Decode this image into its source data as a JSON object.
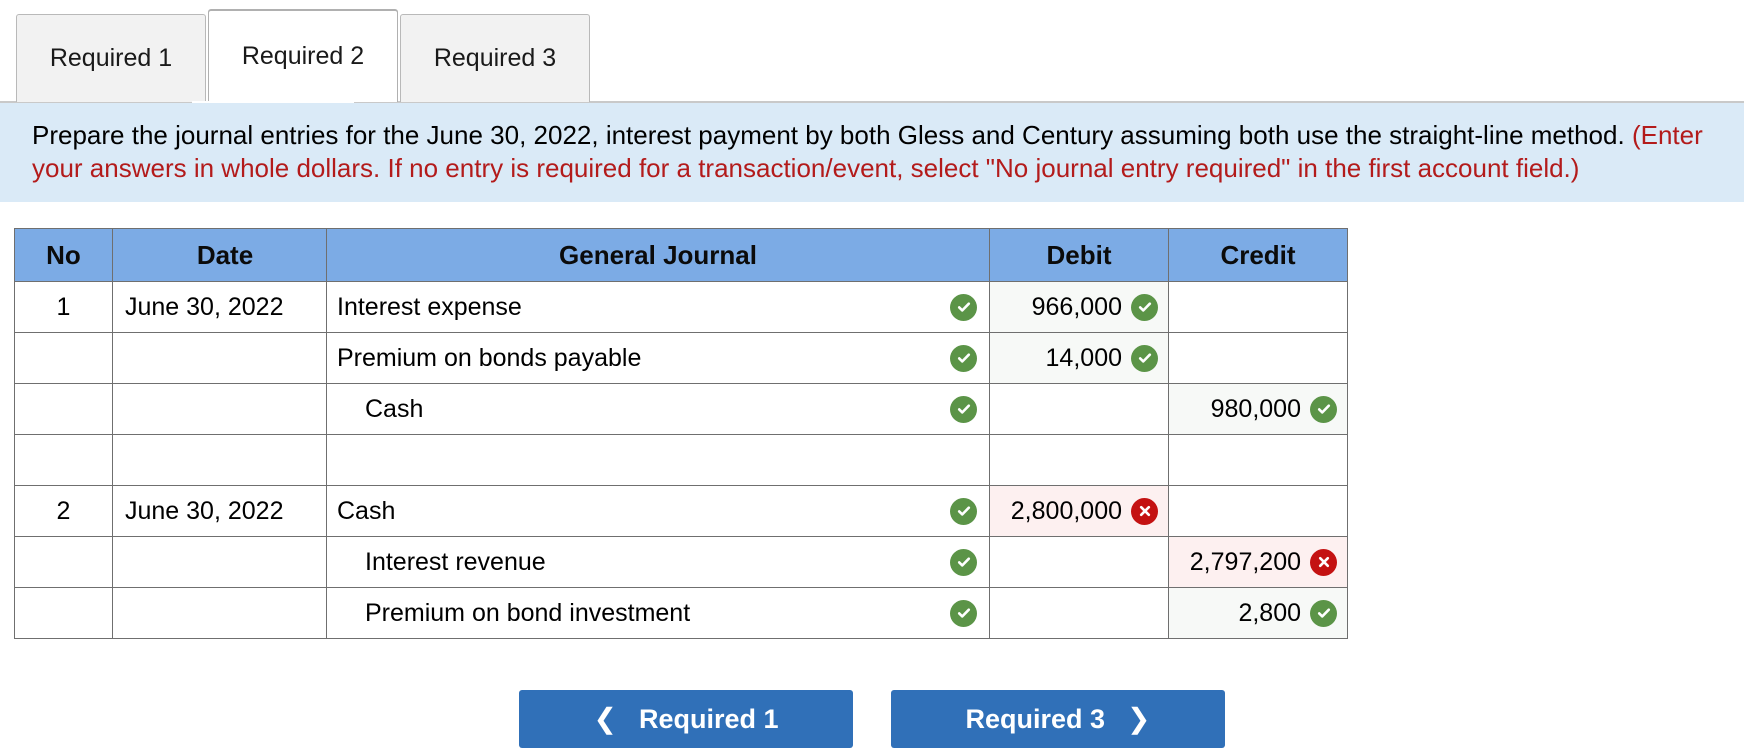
{
  "tabs": [
    {
      "label": "Required 1",
      "active": false
    },
    {
      "label": "Required 2",
      "active": true
    },
    {
      "label": "Required 3",
      "active": false
    }
  ],
  "instruction": {
    "black_text": "Prepare the journal entries for the June 30, 2022, interest payment by both Gless and Century assuming both use the straight-line method. ",
    "red_text": "(Enter your answers in whole dollars. If no entry is required for a transaction/event, select \"No journal entry required\" in the first account field.)"
  },
  "table": {
    "headers": [
      "No",
      "Date",
      "General Journal",
      "Debit",
      "Credit"
    ],
    "rows": [
      {
        "no": "1",
        "date": "June 30, 2022",
        "account": "Interest expense",
        "indent": false,
        "account_status": "ok",
        "debit": "966,000",
        "debit_status": "ok",
        "credit": "",
        "credit_status": "none"
      },
      {
        "no": "",
        "date": "",
        "account": "Premium on bonds payable",
        "indent": false,
        "account_status": "ok",
        "debit": "14,000",
        "debit_status": "ok",
        "credit": "",
        "credit_status": "none"
      },
      {
        "no": "",
        "date": "",
        "account": "Cash",
        "indent": true,
        "account_status": "ok",
        "debit": "",
        "debit_status": "none",
        "credit": "980,000",
        "credit_status": "ok"
      },
      {
        "no": "",
        "date": "",
        "account": "",
        "indent": false,
        "account_status": "none",
        "debit": "",
        "debit_status": "none",
        "credit": "",
        "credit_status": "none"
      },
      {
        "no": "2",
        "date": "June 30, 2022",
        "account": "Cash",
        "indent": false,
        "account_status": "ok",
        "debit": "2,800,000",
        "debit_status": "bad",
        "credit": "",
        "credit_status": "none"
      },
      {
        "no": "",
        "date": "",
        "account": "Interest revenue",
        "indent": true,
        "account_status": "ok",
        "debit": "",
        "debit_status": "none",
        "credit": "2,797,200",
        "credit_status": "bad"
      },
      {
        "no": "",
        "date": "",
        "account": "Premium on bond investment",
        "indent": true,
        "account_status": "ok",
        "debit": "",
        "debit_status": "none",
        "credit": "2,800",
        "credit_status": "ok"
      }
    ]
  },
  "footer": {
    "prev_label": "Required 1",
    "prev_icon": "chevron-left-icon",
    "next_label": "Required 3",
    "next_icon": "chevron-right-icon"
  },
  "colors": {
    "header_blue": "#7cabe5",
    "banner_blue": "#daeaf7",
    "instruction_red": "#b31b1b",
    "button_blue": "#3070b8",
    "correct_green": "#5b9447",
    "incorrect_red": "#c41212",
    "correct_cell_bg": "#f7f9f7",
    "incorrect_cell_bg": "#fdf0f0"
  }
}
